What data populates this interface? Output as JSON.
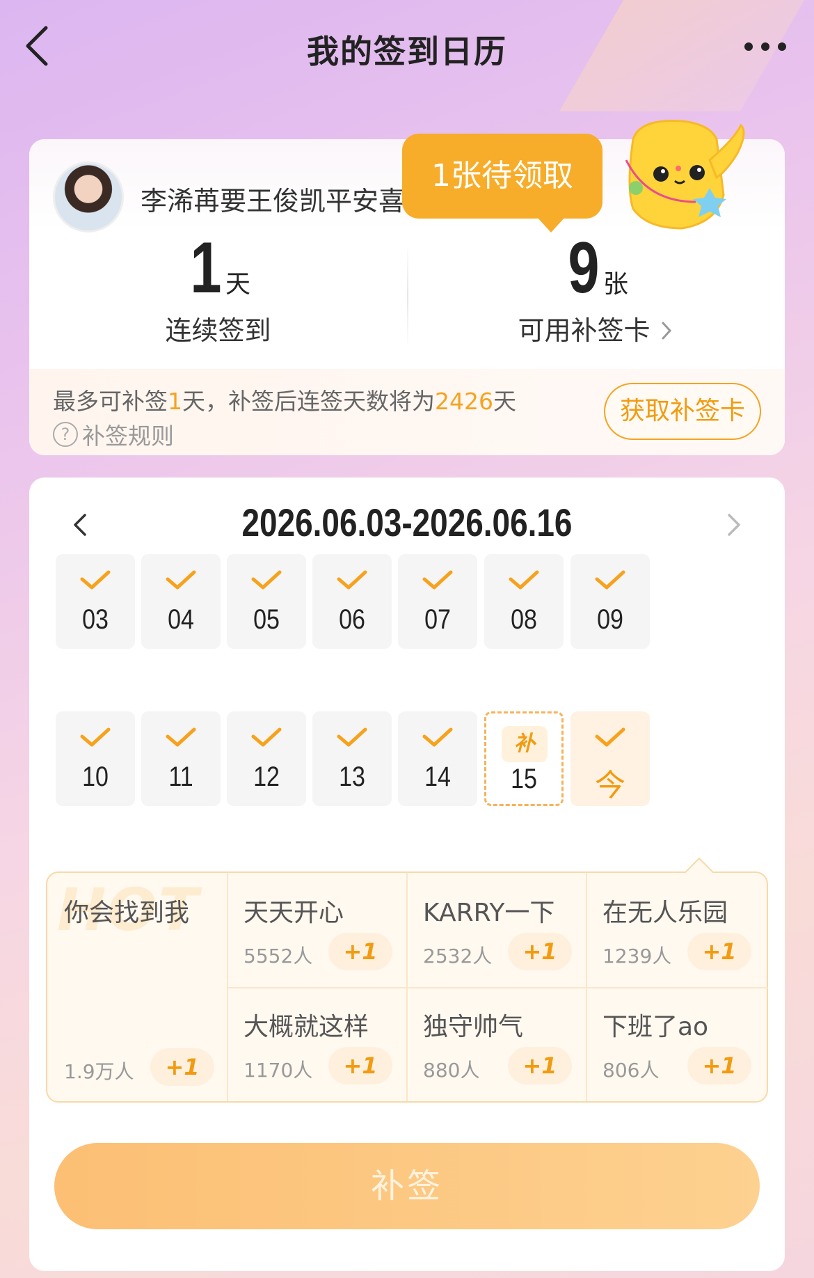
{
  "header": {
    "title": "我的签到日历"
  },
  "profile": {
    "username": "李浠苒要王俊凯平安喜乐k",
    "pending_tooltip": "1张待领取"
  },
  "stats": {
    "streak": {
      "value": "1",
      "unit": "天",
      "label": "连续签到"
    },
    "cards": {
      "value": "9",
      "unit": "张",
      "label": "可用补签卡"
    }
  },
  "makeup_info": {
    "text_prefix": "最多可补签",
    "max_days": "1",
    "text_mid": "天，补签后连签天数将为",
    "result_days": "2426",
    "text_suffix": "天",
    "rules_label": "补签规则",
    "get_card_button": "获取补签卡"
  },
  "calendar": {
    "range": "2026.06.03-2026.06.16",
    "days": [
      {
        "num": "03",
        "status": "checked"
      },
      {
        "num": "04",
        "status": "checked"
      },
      {
        "num": "05",
        "status": "checked"
      },
      {
        "num": "06",
        "status": "checked"
      },
      {
        "num": "07",
        "status": "checked"
      },
      {
        "num": "08",
        "status": "checked"
      },
      {
        "num": "09",
        "status": "checked"
      },
      {
        "num": "10",
        "status": "checked"
      },
      {
        "num": "11",
        "status": "checked"
      },
      {
        "num": "12",
        "status": "checked"
      },
      {
        "num": "13",
        "status": "checked"
      },
      {
        "num": "14",
        "status": "checked"
      },
      {
        "num": "15",
        "status": "makeup",
        "badge": "补"
      },
      {
        "num": "今",
        "status": "today"
      }
    ]
  },
  "hot": {
    "watermark": "HOT",
    "featured": {
      "name": "你会找到我",
      "count": "1.9万人",
      "plus": "+1"
    },
    "items": [
      {
        "name": "天天开心",
        "count": "5552人",
        "plus": "+1"
      },
      {
        "name": "KARRY一下",
        "count": "2532人",
        "plus": "+1"
      },
      {
        "name": "在无人乐园",
        "count": "1239人",
        "plus": "+1"
      },
      {
        "name": "大概就这样",
        "count": "1170人",
        "plus": "+1"
      },
      {
        "name": "独守帅气",
        "count": "880人",
        "plus": "+1"
      },
      {
        "name": "下班了ao",
        "count": "806人",
        "plus": "+1"
      }
    ]
  },
  "footer": {
    "makeup_button": "补签"
  },
  "colors": {
    "accent": "#f6a31f",
    "tooltip": "#f7ad2a",
    "button": "#fcbf74"
  }
}
